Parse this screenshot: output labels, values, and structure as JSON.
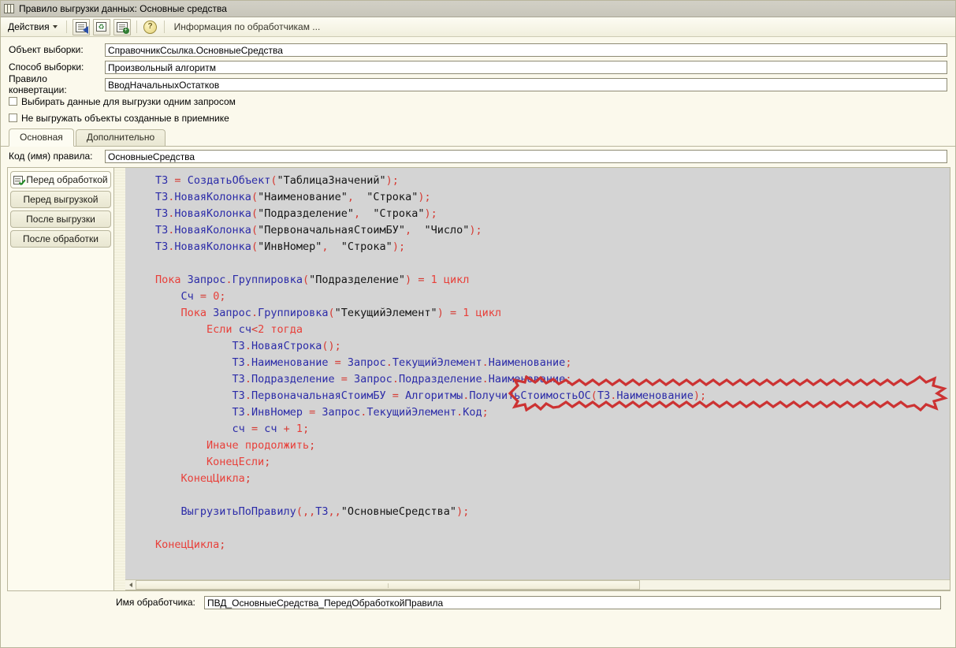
{
  "window": {
    "title": "Правило выгрузки данных: Основные средства",
    "icon": "table-grid-icon"
  },
  "toolbar": {
    "actions_label": "Действия",
    "info_label": "Информация по обработчикам ...",
    "buttons": [
      {
        "name": "save-and-close-icon",
        "title": "Записать и закрыть"
      },
      {
        "name": "refresh-icon",
        "title": "Обновить"
      },
      {
        "name": "copy-add-icon",
        "title": "Добавить копированием"
      },
      {
        "name": "help-icon",
        "title": "Справка",
        "glyph": "?"
      }
    ]
  },
  "form": {
    "fields": [
      {
        "label": "Объект выборки:",
        "value": "СправочникСсылка.ОсновныеСредства"
      },
      {
        "label": "Способ выборки:",
        "value": "Произвольный алгоритм"
      },
      {
        "label": "Правило конвертации:",
        "value": "ВводНачальныхОстатков"
      }
    ],
    "checkboxes": [
      {
        "label": "Выбирать данные для выгрузки одним запросом",
        "checked": false
      },
      {
        "label": "Не выгружать объекты созданные в приемнике",
        "checked": false
      }
    ]
  },
  "tabs": [
    {
      "label": "Основная",
      "active": true
    },
    {
      "label": "Дополнительно",
      "active": false
    }
  ],
  "rule_code": {
    "label": "Код (имя) правила:",
    "value": "ОсновныеСредства"
  },
  "handlers": [
    {
      "label": "Перед обработкой",
      "active": true,
      "icon": "script-check-icon"
    },
    {
      "label": "Перед выгрузкой",
      "active": false
    },
    {
      "label": "После выгрузки",
      "active": false
    },
    {
      "label": "После обработки",
      "active": false
    }
  ],
  "handler_name": {
    "label": "Имя обработчика:",
    "value": "ПВД_ОсновныеСредства_ПередОбработкойПравила"
  },
  "editor": {
    "background": "#d4d4d4",
    "colors": {
      "keyword": "#e8403a",
      "identifier": "#2b2ba8",
      "string": "#151515",
      "punctuation": "#d63b33",
      "annotation": "#cc3333"
    },
    "code_lines": [
      "ТЗ = СоздатьОбъект(\"ТаблицаЗначений\");",
      "ТЗ.НоваяКолонка(\"Наименование\", \"Строка\");",
      "ТЗ.НоваяКолонка(\"Подразделение\", \"Строка\");",
      "ТЗ.НоваяКолонка(\"ПервоначальнаяСтоимБУ\", \"Число\");",
      "ТЗ.НоваяКолонка(\"ИнвНомер\", \"Строка\");",
      "",
      "Пока Запрос.Группировка(\"Подразделение\") = 1 цикл",
      "    Сч = 0;",
      "    Пока Запрос.Группировка(\"ТекущийЭлемент\") = 1 цикл",
      "        Если сч<2 тогда",
      "            ТЗ.НоваяСтрока();",
      "            ТЗ.Наименование = Запрос.ТекущийЭлемент.Наименование;",
      "            ТЗ.Подразделение = Запрос.Подразделение.Наименование;",
      "            ТЗ.ПервоначальнаяСтоимБУ = Алгоритмы.ПолучитьСтоимостьОС(ТЗ.Наименование);",
      "            ТЗ.ИнвНомер = Запрос.ТекущийЭлемент.Код;",
      "            сч = сч + 1;",
      "        Иначе продолжить;",
      "        КонецЕсли;",
      "    КонецЦикла;",
      "",
      "    ВыгрузитьПоПравилу(,,ТЗ,,\"ОсновныеСредства\");",
      "",
      "КонецЦикла;"
    ],
    "annotation": {
      "shape": "jagged-ellipse",
      "color": "#cc3333",
      "targets_line": "ТЗ.ПервоначальнаяСтоимБУ = Алгоритмы.ПолучитьСтоимостьОС(ТЗ.Наименование);"
    }
  },
  "scrollbar": {
    "orientation": "horizontal",
    "left_arrow": "left-arrow-icon"
  }
}
